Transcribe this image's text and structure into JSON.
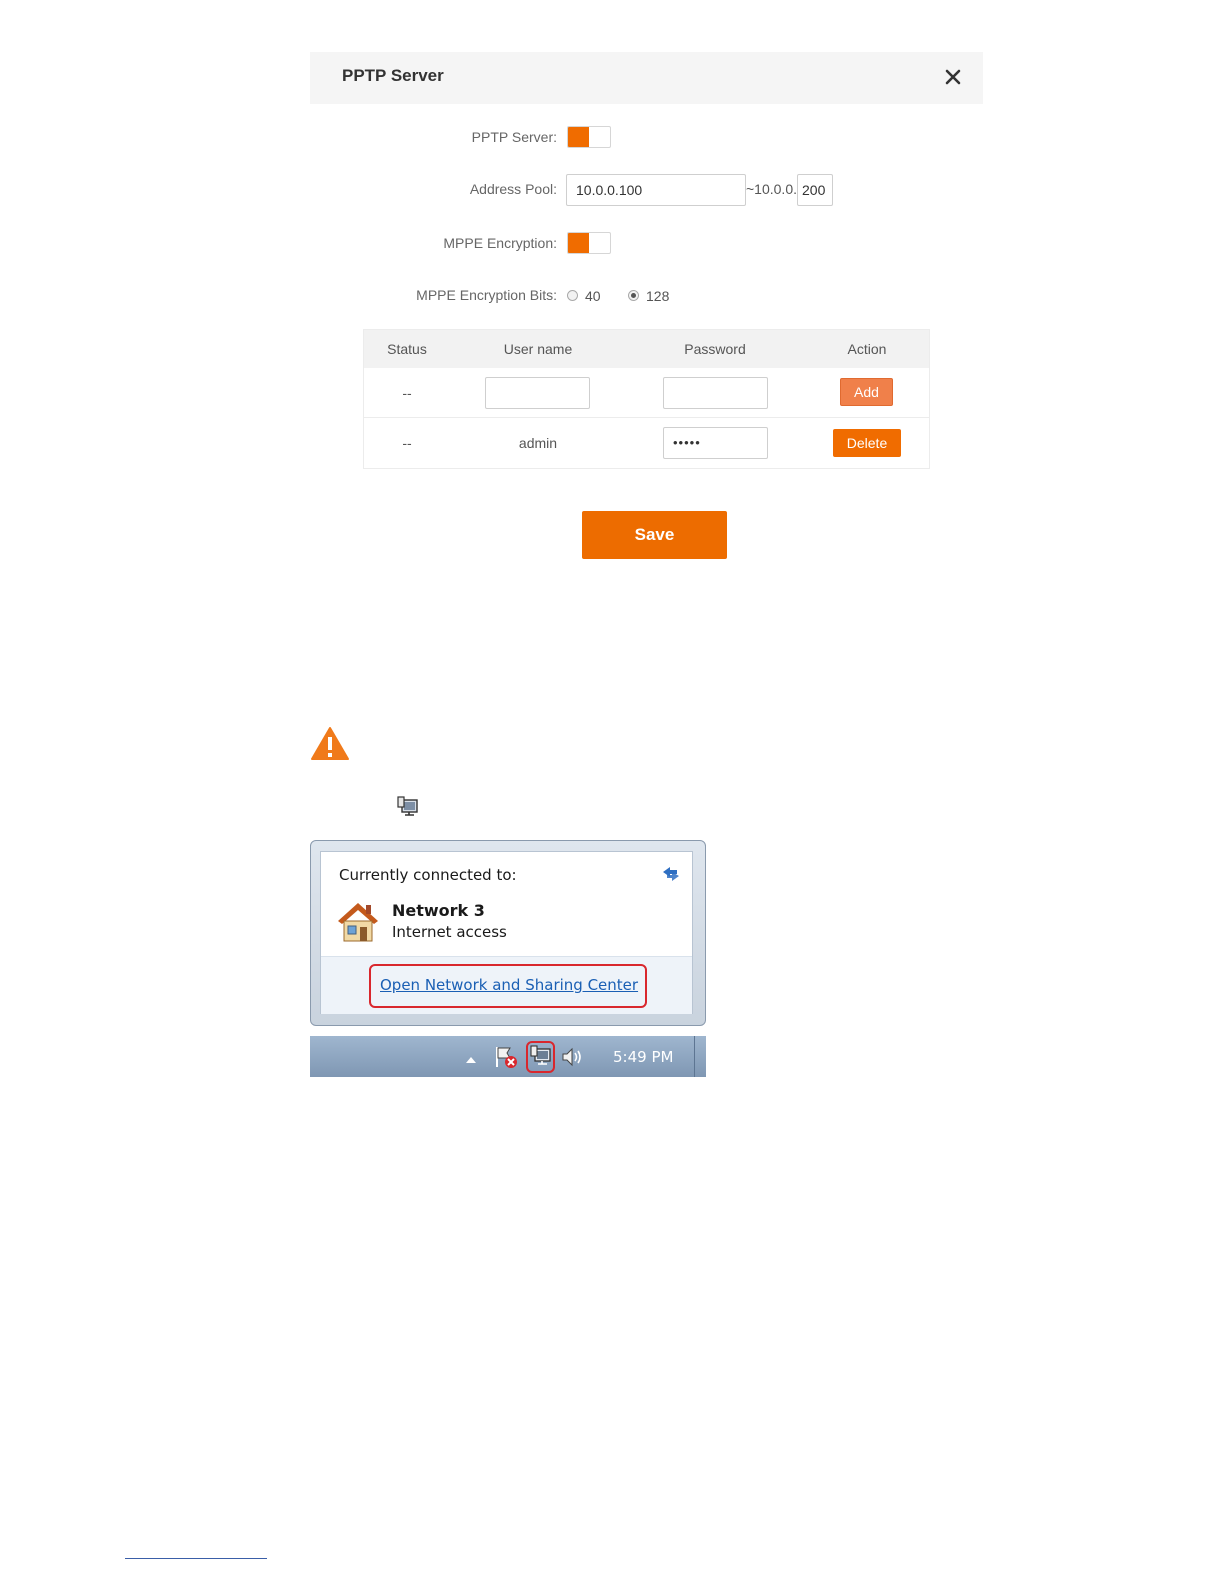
{
  "pptp_dialog": {
    "title": "PPTP Server",
    "close_icon": "close-icon",
    "fields": {
      "pptp_server_label": "PPTP Server:",
      "pptp_server_on": true,
      "address_pool_label": "Address Pool:",
      "address_pool_start": "10.0.0.100",
      "address_pool_separator": "~10.0.0.",
      "address_pool_end": "200",
      "mppe_encryption_label": "MPPE Encryption:",
      "mppe_encryption_on": true,
      "mppe_bits_label": "MPPE Encryption Bits:",
      "mppe_bits_options": [
        "40",
        "128"
      ],
      "mppe_bits_selected": "128"
    },
    "table": {
      "headers": [
        "Status",
        "User name",
        "Password",
        "Action"
      ],
      "new_row": {
        "status": "--",
        "username": "",
        "password": "",
        "action": "Add"
      },
      "rows": [
        {
          "status": "--",
          "username": "admin",
          "password": "•••••",
          "action": "Delete"
        }
      ]
    },
    "save_label": "Save",
    "accent_color": "#f06c00"
  },
  "warning_icon": "warning-icon",
  "inline_network_icon": "network-tray-icon",
  "windows_popup": {
    "connected_label": "Currently connected to:",
    "network_name": "Network  3",
    "network_status": "Internet access",
    "link_label": "Open Network and Sharing Center",
    "taskbar_time": "5:49 PM",
    "tray_icons": [
      "show-hidden-icons-arrow-icon",
      "action-center-flag-icon",
      "network-tray-icon",
      "volume-icon"
    ]
  }
}
